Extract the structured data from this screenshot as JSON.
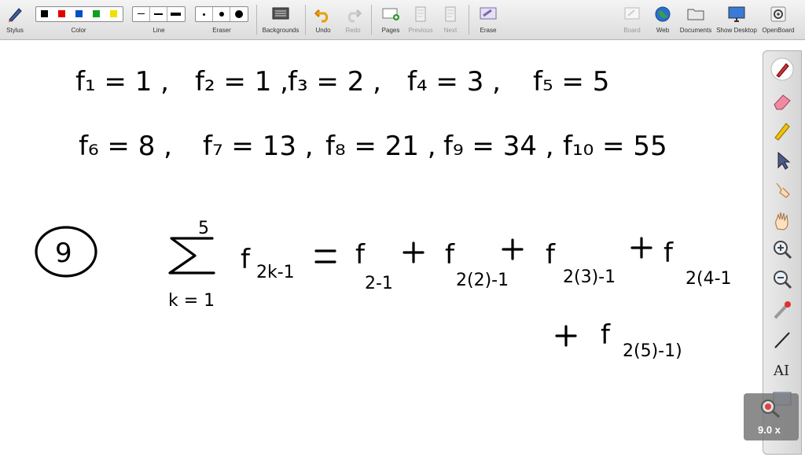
{
  "toolbar": {
    "stylus": "Stylus",
    "color": "Color",
    "line": "Line",
    "eraser": "Eraser",
    "backgrounds": "Backgrounds",
    "undo": "Undo",
    "redo": "Redo",
    "pages": "Pages",
    "previous": "Previous",
    "next": "Next",
    "erase": "Erase",
    "board": "Board",
    "web": "Web",
    "documents": "Documents",
    "show_desktop": "Show Desktop",
    "openboard": "OpenBoard",
    "colors": [
      "#000000",
      "#e00000",
      "#0050c8",
      "#10a020",
      "#f0e000"
    ]
  },
  "notes": {
    "line1": [
      "f₁ = 1 ,",
      "f₂ = 1 ,",
      "f₃ = 2 ,",
      "f₄ = 3 ,",
      "f₅ = 5"
    ],
    "line2": [
      "f₆ = 8 ,",
      "f₇ = 13 ,",
      "f₈ = 21 ,",
      "f₉ = 34 ,",
      "f₁₀ = 55"
    ],
    "problem": "9",
    "sum_upper": "5",
    "sum_lower": "k = 1",
    "sum_term": "f",
    "sum_sub": "2k-1",
    "terms": [
      "2-1",
      "2(2)-1",
      "2(3)-1",
      "2(4-1",
      "2(5)-1)"
    ]
  },
  "zoom": {
    "label": "9.0 x"
  }
}
